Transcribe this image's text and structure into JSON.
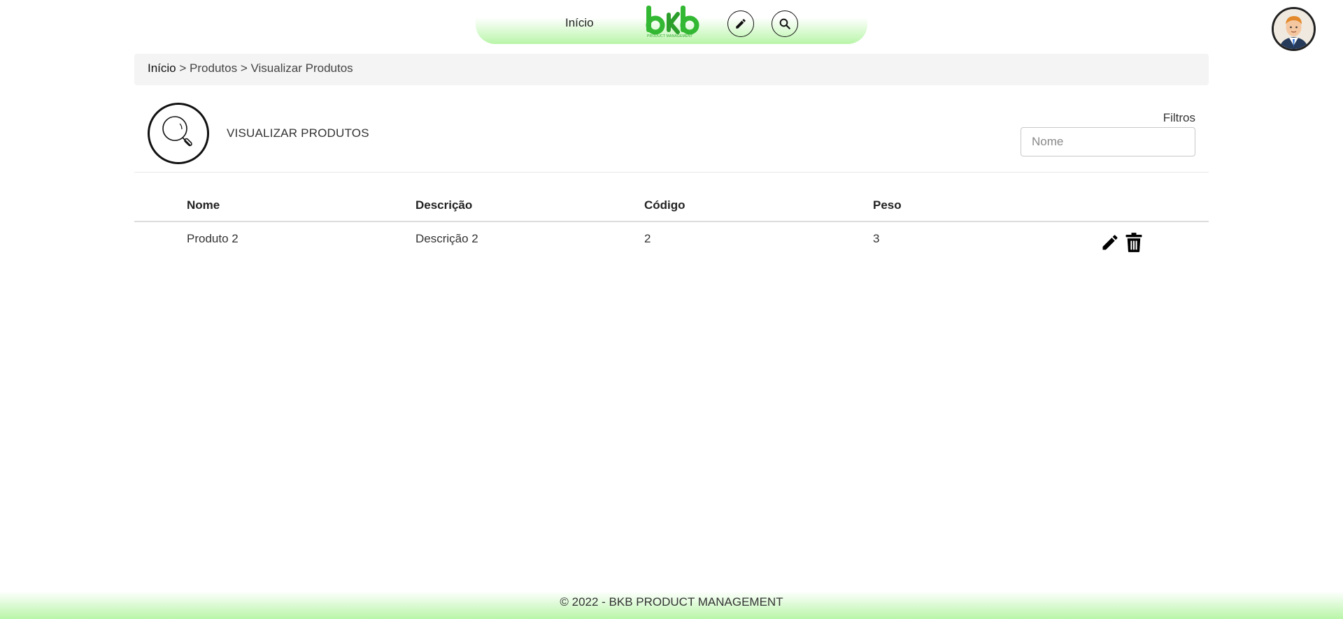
{
  "nav": {
    "home_label": "Início",
    "logo_text": "bkb",
    "logo_subtext": "PRODUCT MANAGEMENT",
    "edit_icon": "pencil-icon",
    "search_icon": "search-icon"
  },
  "user": {
    "avatar_icon": "user-avatar"
  },
  "breadcrumb": {
    "home": "Início",
    "sep1": ">",
    "products": "Produtos",
    "sep2": ">",
    "current": "Visualizar Produtos"
  },
  "page": {
    "title": "VISUALIZAR PRODUTOS",
    "icon": "magnifier-icon",
    "filters_label": "Filtros",
    "filter_placeholder": "Nome",
    "filter_value": ""
  },
  "table": {
    "columns": [
      "Nome",
      "Descrição",
      "Código",
      "Peso"
    ],
    "rows": [
      {
        "nome": "Produto 2",
        "descricao": "Descrição 2",
        "codigo": "2",
        "peso": "3"
      }
    ],
    "row_actions": [
      "edit-icon",
      "trash-icon"
    ]
  },
  "footer": {
    "text": "© 2022 - BKB PRODUCT MANAGEMENT"
  },
  "colors": {
    "accent_green": "#b8f5a8",
    "logo_green": "#33b833"
  }
}
